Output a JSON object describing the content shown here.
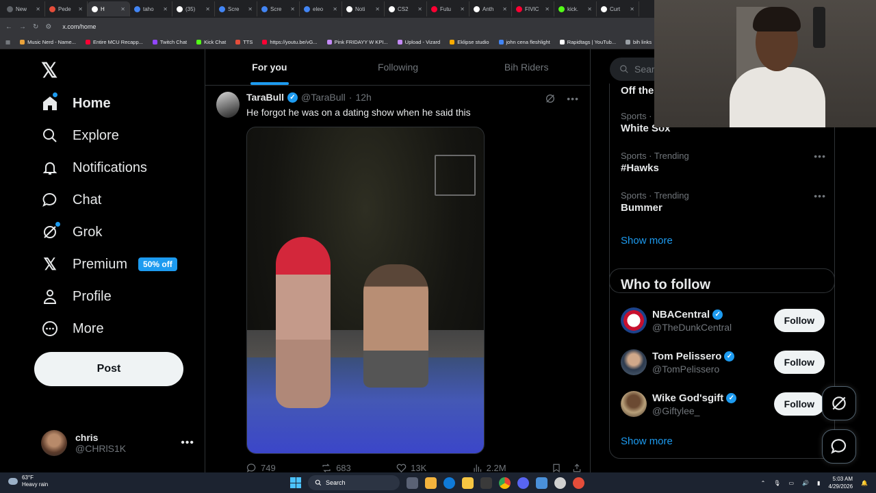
{
  "browser": {
    "tabs": [
      {
        "label": "New",
        "color": "#5f6368"
      },
      {
        "label": "Pede",
        "color": "#e44d3a"
      },
      {
        "label": "H",
        "color": "#ffffff"
      },
      {
        "label": "taho",
        "color": "#4285f4"
      },
      {
        "label": "(35)",
        "color": "#ffffff"
      },
      {
        "label": "Scre",
        "color": "#4285f4"
      },
      {
        "label": "Scre",
        "color": "#4285f4"
      },
      {
        "label": "eleo",
        "color": "#4285f4"
      },
      {
        "label": "Noti",
        "color": "#ffffff"
      },
      {
        "label": "CS2",
        "color": "#ffffff"
      },
      {
        "label": "Futu",
        "color": "#ff0033"
      },
      {
        "label": "Anth",
        "color": "#ffffff"
      },
      {
        "label": "FIVIC",
        "color": "#ff0033"
      },
      {
        "label": "kick.",
        "color": "#53fc18"
      },
      {
        "label": "Curt",
        "color": "#ffffff"
      }
    ],
    "url": "x.com/home",
    "bookmarks": [
      {
        "label": "Music Nerd - Name...",
        "color": "#e9a23b"
      },
      {
        "label": "Entire MCU Recapp...",
        "color": "#ff0033"
      },
      {
        "label": "Twitch Chat",
        "color": "#9146ff"
      },
      {
        "label": "Kick Chat",
        "color": "#53fc18"
      },
      {
        "label": "TTS",
        "color": "#e44d3a"
      },
      {
        "label": "https://youtu.be/vG...",
        "color": "#ff0033"
      },
      {
        "label": "Pink FRIDAYY W KPI...",
        "color": "#c58af9"
      },
      {
        "label": "Upload - Vizard",
        "color": "#c58af9"
      },
      {
        "label": "Eklipse studio",
        "color": "#f9ab00"
      },
      {
        "label": "john cena fleshlight",
        "color": "#4285f4"
      },
      {
        "label": "Rapidtags | YouTub...",
        "color": "#ffffff"
      },
      {
        "label": "bih links",
        "color": "#9aa0a6"
      }
    ]
  },
  "sidebar": {
    "nav": [
      {
        "label": "Home",
        "icon": "home-icon"
      },
      {
        "label": "Explore",
        "icon": "search-icon"
      },
      {
        "label": "Notifications",
        "icon": "bell-icon"
      },
      {
        "label": "Chat",
        "icon": "chat-icon"
      },
      {
        "label": "Grok",
        "icon": "grok-icon"
      },
      {
        "label": "Premium",
        "icon": "x-icon"
      },
      {
        "label": "Profile",
        "icon": "person-icon"
      },
      {
        "label": "More",
        "icon": "more-circle-icon"
      }
    ],
    "premium_badge": "50% off",
    "post_label": "Post",
    "account": {
      "name": "chris",
      "handle": "@CHRlS1K"
    }
  },
  "timeline": {
    "tabs": [
      "For you",
      "Following",
      "Bih Riders"
    ],
    "tweet": {
      "name": "TaraBull",
      "handle": "@TaraBull",
      "dot": "·",
      "time": "12h",
      "text": "He forgot he was on a dating show when he said this",
      "replies": "749",
      "reposts": "683",
      "likes": "13K",
      "views": "2.2M"
    }
  },
  "right": {
    "search_placeholder": "Searc",
    "trends_partial_title": "Off the",
    "trends": [
      {
        "meta": "Sports · T",
        "name": "White Sox"
      },
      {
        "meta": "Sports · Trending",
        "name": "#Hawks"
      },
      {
        "meta": "Sports · Trending",
        "name": "Bummer"
      }
    ],
    "show_more": "Show more",
    "who_to_follow": {
      "title": "Who to follow",
      "accounts": [
        {
          "name": "NBACentral",
          "handle": "@TheDunkCentral",
          "avatar_color": "#d9d9d9"
        },
        {
          "name": "Tom Pelissero",
          "handle": "@TomPelissero",
          "avatar_color": "#3b4a5e"
        },
        {
          "name": "Wike God'sgift",
          "handle": "@Giftylee_",
          "avatar_color": "#8a6a4a"
        }
      ],
      "follow_label": "Follow",
      "show_more": "Show more"
    }
  },
  "taskbar": {
    "weather_temp": "63°F",
    "weather_desc": "Heavy rain",
    "search_label": "Search",
    "time": "5:03 AM",
    "date": "4/29/2026"
  },
  "colors": {
    "accent": "#1d9bf0",
    "background": "#000000",
    "muted": "#71767b"
  }
}
